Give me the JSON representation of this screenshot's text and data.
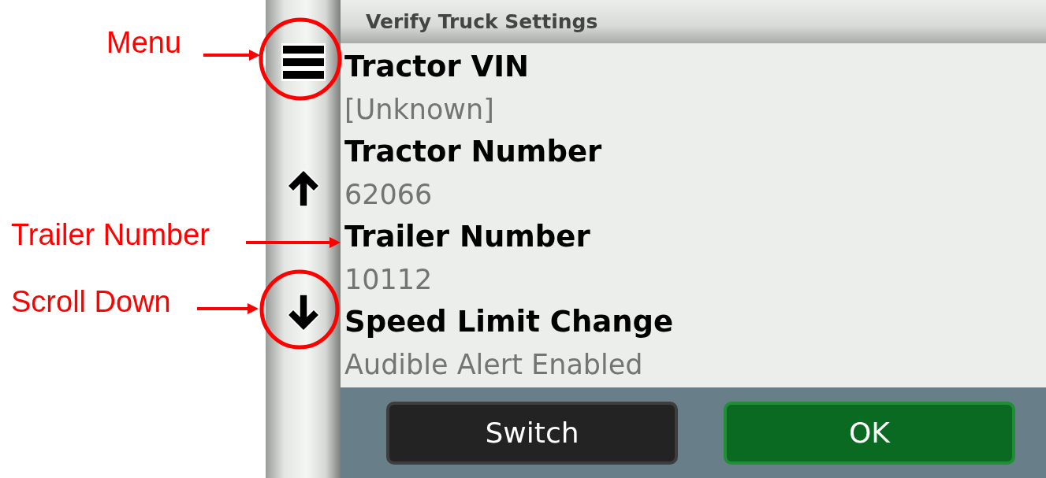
{
  "annotations": [
    {
      "label": "Menu",
      "kind": "circled"
    },
    {
      "label": "Trailer Number",
      "kind": "pointer"
    },
    {
      "label": "Scroll Down",
      "kind": "circled"
    }
  ],
  "window": {
    "title": "Verify Truck Settings"
  },
  "settings": [
    {
      "label": "Tractor VIN",
      "value": "[Unknown]"
    },
    {
      "label": "Tractor Number",
      "value": "62066"
    },
    {
      "label": "Trailer Number",
      "value": "10112"
    },
    {
      "label": "Speed Limit Change",
      "value": "Audible Alert Enabled"
    }
  ],
  "buttons": [
    {
      "label": "Switch",
      "kind": "secondary"
    },
    {
      "label": "OK",
      "kind": "primary"
    }
  ]
}
